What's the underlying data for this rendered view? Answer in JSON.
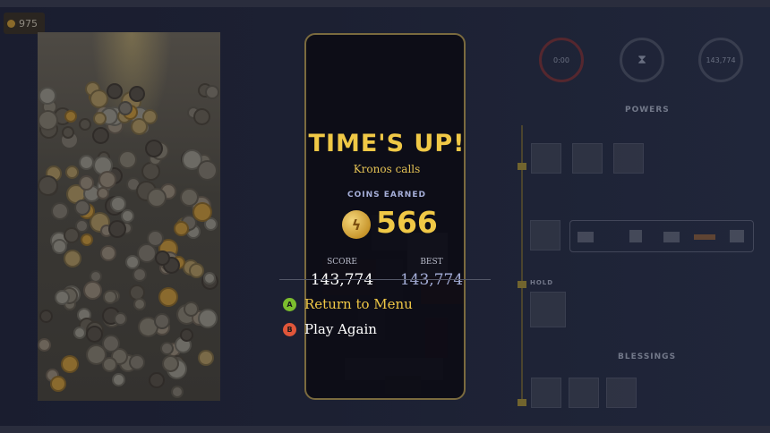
{
  "hud": {
    "coin_counter": "975",
    "dials": [
      "0:00",
      "",
      "143,774"
    ],
    "hourglass_icon": "hourglass-icon",
    "powers_label": "POWERS",
    "hold_label": "HOLD",
    "blessings_label": "BLESSINGS"
  },
  "modal": {
    "title": "TIME'S UP!",
    "subtitle": "Kronos calls",
    "coins_label": "COINS EARNED",
    "coins_icon": "lightning-coin-icon",
    "coins_value": "566",
    "score_label": "SCORE",
    "score_value": "143,774",
    "best_label": "BEST",
    "best_value": "143,774"
  },
  "menu": {
    "return": {
      "badge": "A",
      "label": "Return to Menu"
    },
    "play_again": {
      "badge": "B",
      "label": "Play Again"
    }
  },
  "colors": {
    "accent_gold": "#f0c846",
    "button_a": "#7cbd2e",
    "button_b": "#e0563a",
    "best_text": "#a5aed8",
    "modal_border": "#7a6a3e"
  }
}
